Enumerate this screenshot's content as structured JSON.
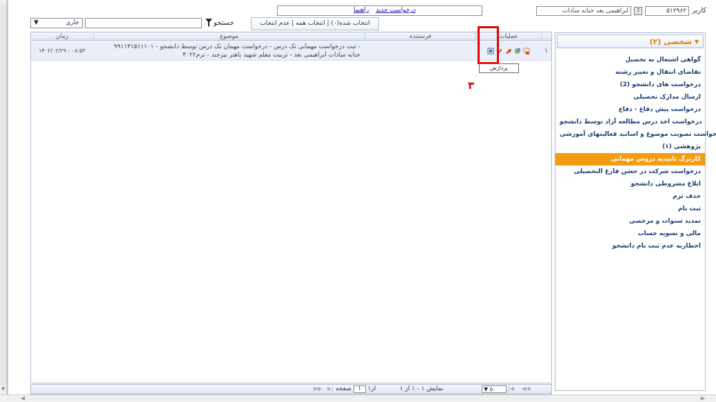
{
  "user": {
    "label": "کاربر",
    "id": "۵۱۲۹۶۲",
    "name": "ابراهیمی بعد حنانه سادات"
  },
  "links": {
    "new_request": "درخواست جدید",
    "help": "راهنما"
  },
  "toolbar": {
    "selection_info": "انتخاب شده(۰) | انتخاب همه | عدم انتخاب",
    "search_label": "جستجو",
    "search_value": "",
    "filter_value": "جاری"
  },
  "grid": {
    "headers": {
      "time": "زمان",
      "subject": "موضوع",
      "sender": "فرستنده",
      "operations": "عملیات"
    },
    "row": {
      "number": "۱",
      "time": "۱۴۰۲/۰۲/۲۹ - ۰۸:۵۳",
      "subject_line1": "ثبت درخواست مهمانی تک درس - درخواست مهمان تک درس توسط دانشجو - ۹۹۱۱۳۱۵۱۱۱۰۱ -",
      "subject_line2": "حنانه سادات ابراهیمی بعد - تربیت معلم شهید باهنر بیرجند - ترم۴۰۲۲",
      "sender": ""
    },
    "tooltip": "پردازش",
    "step_marker": "۳"
  },
  "pager": {
    "page_label": "صفحه",
    "page_value": "۱",
    "page_of": "از۱",
    "page_size": "۵۰",
    "display_info": "نمایش ۱ - ۱ از ۱"
  },
  "side_panel": {
    "title": "شخصی (۲)",
    "items": [
      {
        "label": "گواهی اشتغال به تحصیل",
        "active": false
      },
      {
        "label": "تقاضای انتقال و تغییر رشته",
        "active": false
      },
      {
        "label": "درخواست های دانشجو (2)",
        "active": false
      },
      {
        "label": "ارسال مدارک تحصیلی",
        "active": false
      },
      {
        "label": "درخواست پیش دفاع - دفاع",
        "active": false
      },
      {
        "label": "درخواست اخذ درس مطالعه آزاد توسط دانشجو",
        "active": false
      },
      {
        "label": "درخواست تصویب موضوع و اساتید فعالیتهای آموزشی-",
        "active": false
      },
      {
        "label": "پژوهشی (۱)",
        "active": false
      },
      {
        "label": "کاربرگ تاییدیه دروس مهمانی",
        "active": true
      },
      {
        "label": "درخواست شرکت در جشن فارغ التحصیلی",
        "active": false
      },
      {
        "label": "ابلاغ مشروطی دانشجو",
        "active": false
      },
      {
        "label": "حذف ترم",
        "active": false
      },
      {
        "label": "ثبت نام",
        "active": false
      },
      {
        "label": "تمدید سنوات و مرخصی",
        "active": false
      },
      {
        "label": "مالی و تسویه حساب",
        "active": false
      },
      {
        "label": "اخطاریه عدم ثبت نام دانشجو",
        "active": false
      }
    ]
  },
  "colors": {
    "active_item": "#f39c12",
    "highlight": "#e60000",
    "link": "#1a0dab"
  }
}
